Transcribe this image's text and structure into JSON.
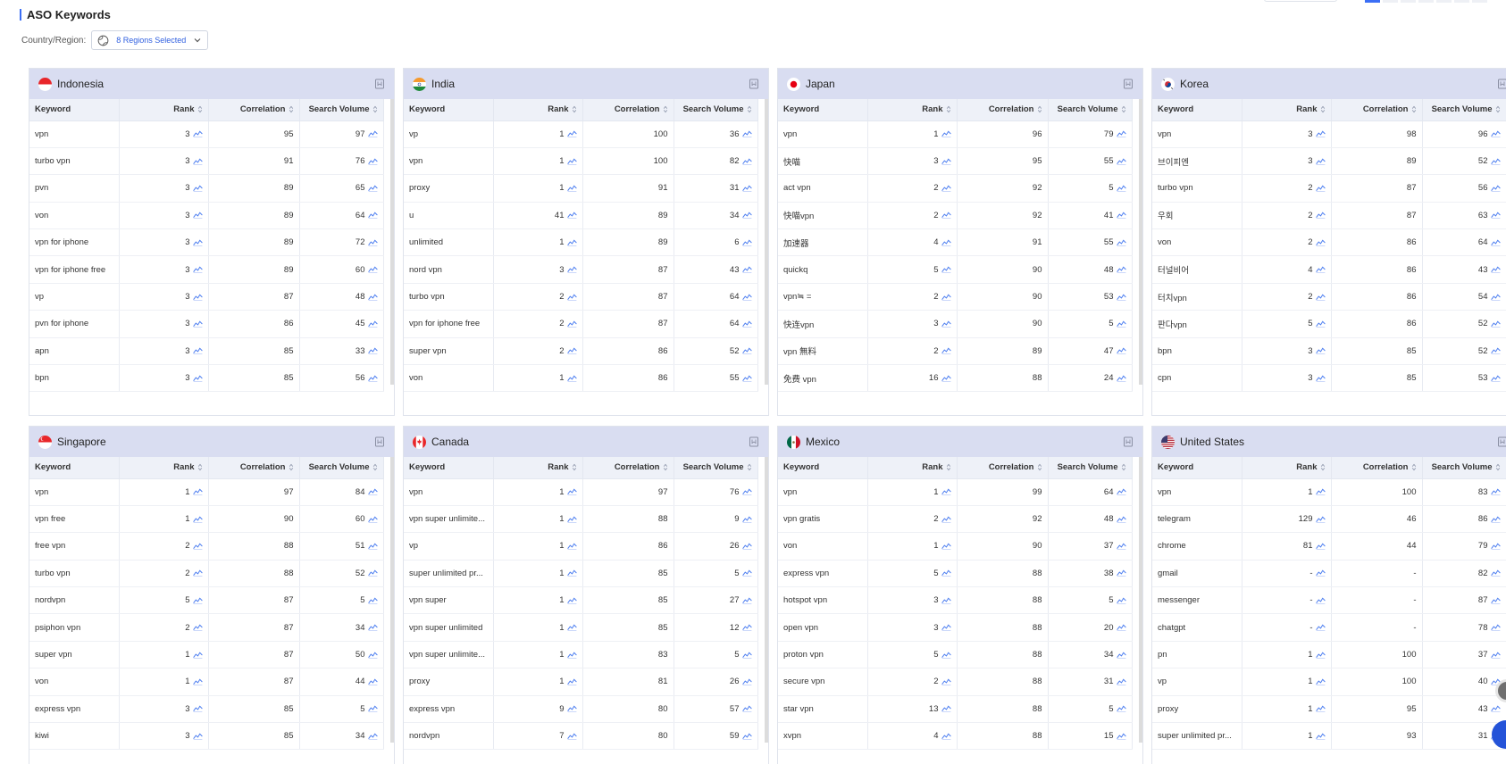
{
  "page": {
    "title": "ASO Keywords"
  },
  "filter": {
    "label": "Country/Region:",
    "selected": "8 Regions Selected"
  },
  "columns": {
    "keyword": "Keyword",
    "rank": "Rank",
    "correlation": "Correlation",
    "volume": "Search Volume"
  },
  "regions": [
    {
      "name": "Indonesia",
      "flag": "indonesia",
      "rows": [
        [
          "vpn",
          "3",
          "95",
          "97"
        ],
        [
          "turbo vpn",
          "3",
          "91",
          "76"
        ],
        [
          "pvn",
          "3",
          "89",
          "65"
        ],
        [
          "von",
          "3",
          "89",
          "64"
        ],
        [
          "vpn for iphone",
          "3",
          "89",
          "72"
        ],
        [
          "vpn for iphone free",
          "3",
          "89",
          "60"
        ],
        [
          "vp",
          "3",
          "87",
          "48"
        ],
        [
          "pvn for iphone",
          "3",
          "86",
          "45"
        ],
        [
          "apn",
          "3",
          "85",
          "33"
        ],
        [
          "bpn",
          "3",
          "85",
          "56"
        ]
      ]
    },
    {
      "name": "India",
      "flag": "india",
      "rows": [
        [
          "vp",
          "1",
          "100",
          "36"
        ],
        [
          "vpn",
          "1",
          "100",
          "82"
        ],
        [
          "proxy",
          "1",
          "91",
          "31"
        ],
        [
          "u",
          "41",
          "89",
          "34"
        ],
        [
          "unlimited",
          "1",
          "89",
          "6"
        ],
        [
          "nord vpn",
          "3",
          "87",
          "43"
        ],
        [
          "turbo vpn",
          "2",
          "87",
          "64"
        ],
        [
          "vpn for iphone free",
          "2",
          "87",
          "64"
        ],
        [
          "super vpn",
          "2",
          "86",
          "52"
        ],
        [
          "von",
          "1",
          "86",
          "55"
        ]
      ]
    },
    {
      "name": "Japan",
      "flag": "japan",
      "rows": [
        [
          "vpn",
          "1",
          "96",
          "79"
        ],
        [
          "快喵",
          "3",
          "95",
          "55"
        ],
        [
          "act vpn",
          "2",
          "92",
          "5"
        ],
        [
          "快喵vpn",
          "2",
          "92",
          "41"
        ],
        [
          "加速器",
          "4",
          "91",
          "55"
        ],
        [
          "quickq",
          "5",
          "90",
          "48"
        ],
        [
          "vpn≒ =",
          "2",
          "90",
          "53"
        ],
        [
          "快连vpn",
          "3",
          "90",
          "5"
        ],
        [
          "vpn 無料",
          "2",
          "89",
          "47"
        ],
        [
          "免费 vpn",
          "16",
          "88",
          "24"
        ]
      ]
    },
    {
      "name": "Korea",
      "flag": "korea",
      "rows": [
        [
          "vpn",
          "3",
          "98",
          "96"
        ],
        [
          "브이피엔",
          "3",
          "89",
          "52"
        ],
        [
          "turbo vpn",
          "2",
          "87",
          "56"
        ],
        [
          "우회",
          "2",
          "87",
          "63"
        ],
        [
          "von",
          "2",
          "86",
          "64"
        ],
        [
          "터널비어",
          "4",
          "86",
          "43"
        ],
        [
          "터치vpn",
          "2",
          "86",
          "54"
        ],
        [
          "판다vpn",
          "5",
          "86",
          "52"
        ],
        [
          "bpn",
          "3",
          "85",
          "52"
        ],
        [
          "cpn",
          "3",
          "85",
          "53"
        ]
      ]
    },
    {
      "name": "Singapore",
      "flag": "singapore",
      "rows": [
        [
          "vpn",
          "1",
          "97",
          "84"
        ],
        [
          "vpn free",
          "1",
          "90",
          "60"
        ],
        [
          "free vpn",
          "2",
          "88",
          "51"
        ],
        [
          "turbo vpn",
          "2",
          "88",
          "52"
        ],
        [
          "nordvpn",
          "5",
          "87",
          "5"
        ],
        [
          "psiphon vpn",
          "2",
          "87",
          "34"
        ],
        [
          "super vpn",
          "1",
          "87",
          "50"
        ],
        [
          "von",
          "1",
          "87",
          "44"
        ],
        [
          "express vpn",
          "3",
          "85",
          "5"
        ],
        [
          "kiwi",
          "3",
          "85",
          "34"
        ]
      ]
    },
    {
      "name": "Canada",
      "flag": "canada",
      "rows": [
        [
          "vpn",
          "1",
          "97",
          "76"
        ],
        [
          "vpn super unlimite...",
          "1",
          "88",
          "9"
        ],
        [
          "vp",
          "1",
          "86",
          "26"
        ],
        [
          "super unlimited pr...",
          "1",
          "85",
          "5"
        ],
        [
          "vpn super",
          "1",
          "85",
          "27"
        ],
        [
          "vpn super unlimited",
          "1",
          "85",
          "12"
        ],
        [
          "vpn super unlimite...",
          "1",
          "83",
          "5"
        ],
        [
          "proxy",
          "1",
          "81",
          "26"
        ],
        [
          "express vpn",
          "9",
          "80",
          "57"
        ],
        [
          "nordvpn",
          "7",
          "80",
          "59"
        ]
      ]
    },
    {
      "name": "Mexico",
      "flag": "mexico",
      "rows": [
        [
          "vpn",
          "1",
          "99",
          "64"
        ],
        [
          "vpn gratis",
          "2",
          "92",
          "48"
        ],
        [
          "von",
          "1",
          "90",
          "37"
        ],
        [
          "express vpn",
          "5",
          "88",
          "38"
        ],
        [
          "hotspot vpn",
          "3",
          "88",
          "5"
        ],
        [
          "open vpn",
          "3",
          "88",
          "20"
        ],
        [
          "proton vpn",
          "5",
          "88",
          "34"
        ],
        [
          "secure vpn",
          "2",
          "88",
          "31"
        ],
        [
          "star vpn",
          "13",
          "88",
          "5"
        ],
        [
          "xvpn",
          "4",
          "88",
          "15"
        ]
      ]
    },
    {
      "name": "United States",
      "flag": "usa",
      "rows": [
        [
          "vpn",
          "1",
          "100",
          "83"
        ],
        [
          "telegram",
          "129",
          "46",
          "86"
        ],
        [
          "chrome",
          "81",
          "44",
          "79"
        ],
        [
          "gmail",
          "-",
          "-",
          "82"
        ],
        [
          "messenger",
          "-",
          "-",
          "87"
        ],
        [
          "chatgpt",
          "-",
          "-",
          "78"
        ],
        [
          "pn",
          "1",
          "100",
          "37"
        ],
        [
          "vp",
          "1",
          "100",
          "40"
        ],
        [
          "proxy",
          "1",
          "95",
          "43"
        ],
        [
          "super unlimited pr...",
          "1",
          "93",
          "31"
        ]
      ]
    }
  ]
}
